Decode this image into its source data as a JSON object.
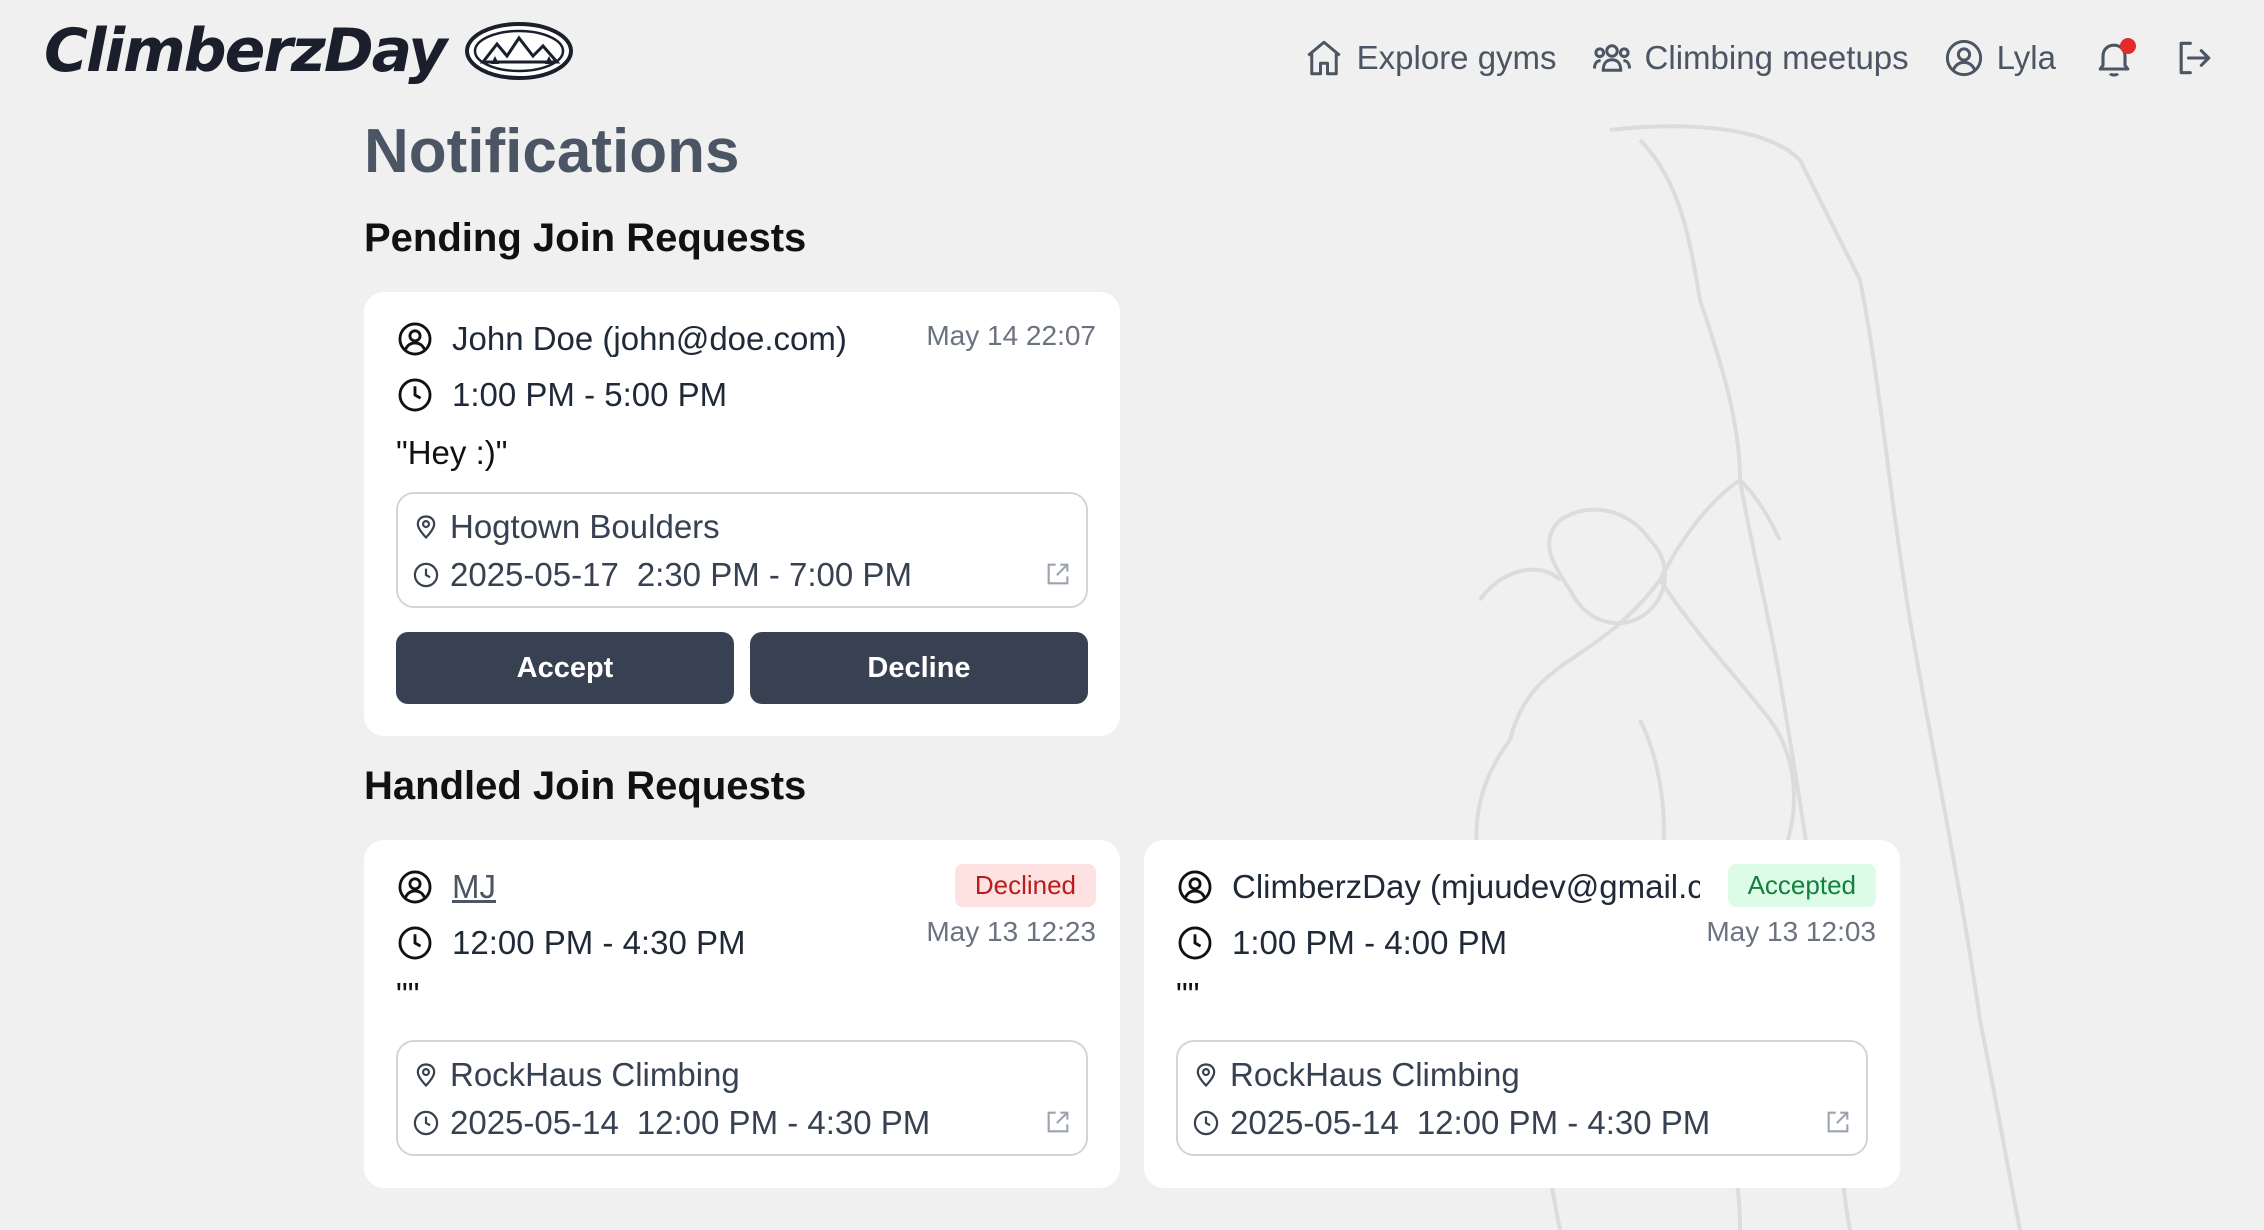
{
  "brand": {
    "name": "ClimberzDay"
  },
  "nav": {
    "explore_label": "Explore gyms",
    "meetups_label": "Climbing meetups",
    "user_label": "Lyla",
    "notification_dot_color": "#e32b2b"
  },
  "page": {
    "title": "Notifications",
    "pending_title": "Pending Join Requests",
    "handled_title": "Handled Join Requests"
  },
  "pending": [
    {
      "requester": "John Doe (john@doe.com)",
      "time": "1:00 PM - 5:00 PM",
      "message": "\"Hey :)\"",
      "timestamp": "May 14 22:07",
      "gym": "Hogtown Boulders",
      "date": "2025-05-17",
      "session": "2:30 PM - 7:00 PM",
      "accept_label": "Accept",
      "decline_label": "Decline"
    }
  ],
  "handled": [
    {
      "requester": "MJ",
      "time": "12:00 PM - 4:30 PM",
      "message": "\"\"",
      "status": "Declined",
      "timestamp": "May 13 12:23",
      "gym": "RockHaus Climbing",
      "date": "2025-05-14",
      "session": "12:00 PM - 4:30 PM"
    },
    {
      "requester": "ClimberzDay (mjuudev@gmail.com)",
      "time": "1:00 PM - 4:00 PM",
      "message": "\"\"",
      "status": "Accepted",
      "timestamp": "May 13 12:03",
      "gym": "RockHaus Climbing",
      "date": "2025-05-14",
      "session": "12:00 PM - 4:30 PM"
    }
  ],
  "colors": {
    "background": "#f0f0f0",
    "button": "#374151",
    "declined_bg": "#fee2e2",
    "declined_text": "#b91c1c",
    "accepted_bg": "#dcfce7",
    "accepted_text": "#15803d"
  }
}
